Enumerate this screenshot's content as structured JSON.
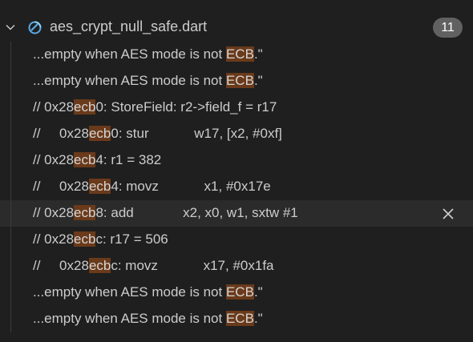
{
  "file": {
    "name": "aes_crypt_null_safe.dart",
    "match_count": "11",
    "icon": "dart-file-icon"
  },
  "search_term": "ecb",
  "results": [
    {
      "before": "...empty when AES mode is not ",
      "match": "ECB",
      "after": ".\"",
      "selected": false
    },
    {
      "before": "...empty when AES mode is not ",
      "match": "ECB",
      "after": ".\"",
      "selected": false
    },
    {
      "before": "// 0x28",
      "match": "ecb",
      "after": "0: StoreField: r2->field_f = r17",
      "selected": false
    },
    {
      "before": "//     0x28",
      "match": "ecb",
      "after": "0: stur            w17, [x2, #0xf]",
      "selected": false
    },
    {
      "before": "// 0x28",
      "match": "ecb",
      "after": "4: r1 = 382",
      "selected": false
    },
    {
      "before": "//     0x28",
      "match": "ecb",
      "after": "4: movz            x1, #0x17e",
      "selected": false
    },
    {
      "before": "// 0x28",
      "match": "ecb",
      "after": "8: add             x2, x0, w1, sxtw #1",
      "selected": true
    },
    {
      "before": "// 0x28",
      "match": "ecb",
      "after": "c: r17 = 506",
      "selected": false
    },
    {
      "before": "//     0x28",
      "match": "ecb",
      "after": "c: movz            x17, #0x1fa",
      "selected": false
    },
    {
      "before": "...empty when AES mode is not ",
      "match": "ECB",
      "after": ".\"",
      "selected": false
    },
    {
      "before": "...empty when AES mode is not ",
      "match": "ECB",
      "after": ".\"",
      "selected": false
    }
  ],
  "colors": {
    "background": "#1f1f1f",
    "match_highlight": "#6a3a1a",
    "selected_row": "#2b2b2b",
    "badge": "#616161"
  }
}
